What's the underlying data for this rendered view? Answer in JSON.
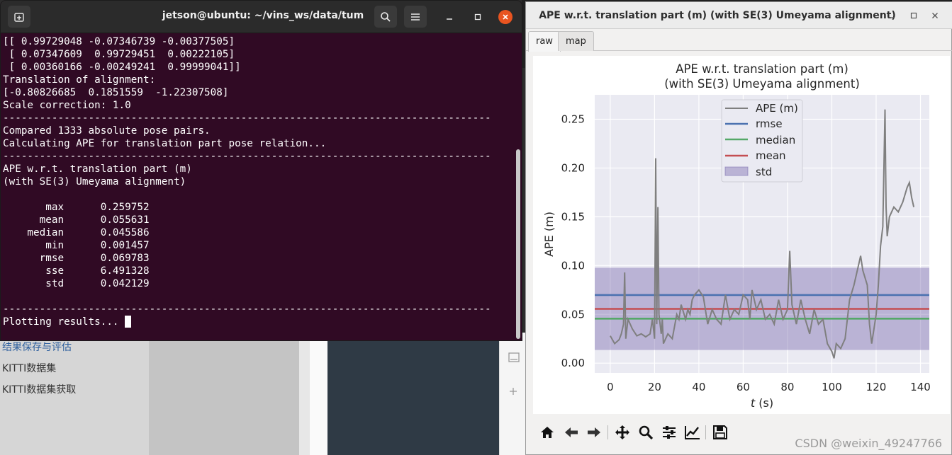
{
  "background": {
    "links": [
      "结果保存与评估",
      "KITTI数据集",
      "KITTI数据集获取"
    ]
  },
  "terminal": {
    "title": "jetson@ubuntu: ~/vins_ws/data/tum",
    "output": "[[ 0.99729048 -0.07346739 -0.00377505]\n [ 0.07347609  0.99729451  0.00222105]\n [ 0.00360166 -0.00249241  0.99999041]]\nTranslation of alignment:\n[-0.80826685  0.1851559  -1.22307508]\nScale correction: 1.0\n--------------------------------------------------------------------------------\nCompared 1333 absolute pose pairs.\nCalculating APE for translation part pose relation...\n--------------------------------------------------------------------------------\nAPE w.r.t. translation part (m)\n(with SE(3) Umeyama alignment)\n\n       max      0.259752\n      mean      0.055631\n    median      0.045586\n       min      0.001457\n      rmse      0.069783\n       sse      6.491328\n       std      0.042129\n\n--------------------------------------------------------------------------------\nPlotting results... "
  },
  "plot_window": {
    "title": "APE w.r.t. translation part (m) (with SE(3) Umeyama alignment)",
    "tabs": [
      "raw",
      "map"
    ],
    "active_tab": "raw",
    "toolbar": [
      "home-icon",
      "back-icon",
      "forward-icon",
      "pan-icon",
      "zoom-icon",
      "configure-subplots-icon",
      "edit-axis-icon",
      "save-icon"
    ]
  },
  "watermark": "CSDN @weixin_49247766",
  "chart_data": {
    "type": "line",
    "title_lines": [
      "APE w.r.t. translation part (m)",
      "(with SE(3) Umeyama alignment)"
    ],
    "xlabel_italic": "t",
    "xlabel_rest": " (s)",
    "ylabel": "APE (m)",
    "xlim": [
      -7,
      144
    ],
    "ylim": [
      -0.01,
      0.275
    ],
    "xticks": [
      0,
      20,
      40,
      60,
      80,
      100,
      120,
      140
    ],
    "yticks": [
      0.0,
      0.05,
      0.1,
      0.15,
      0.2,
      0.25
    ],
    "ytick_labels": [
      "0.00",
      "0.05",
      "0.10",
      "0.15",
      "0.20",
      "0.25"
    ],
    "grid": true,
    "legend_position": "top-center",
    "colors": {
      "ape": "#7f7f7f",
      "rmse": "#4c72b0",
      "median": "#55a868",
      "mean": "#c44e52",
      "std": "#8172b2",
      "plot_bg": "#eaeaf2"
    },
    "stats": {
      "rmse": 0.069783,
      "median": 0.045586,
      "mean": 0.055631,
      "std": 0.042129
    },
    "legend": [
      "APE (m)",
      "rmse",
      "median",
      "mean",
      "std"
    ],
    "series": [
      {
        "name": "APE (m)",
        "x": [
          0,
          2,
          4,
          5,
          6,
          6.5,
          7,
          8,
          10,
          12,
          14,
          16,
          18,
          19,
          20,
          20.5,
          21,
          21.5,
          22,
          23,
          23.5,
          24,
          25,
          26,
          28,
          30,
          31,
          32,
          34,
          35,
          36,
          37,
          38,
          40,
          42,
          44,
          46,
          48,
          50,
          52,
          54,
          56,
          58,
          60,
          62,
          63,
          64,
          66,
          68,
          70,
          72,
          74,
          76,
          78,
          80,
          81,
          82,
          84,
          86,
          88,
          90,
          92,
          94,
          96,
          98,
          100,
          101,
          102,
          104,
          106,
          108,
          110,
          112,
          113,
          114,
          116,
          117,
          118,
          119,
          120,
          121,
          122,
          123,
          124,
          124.5,
          125,
          126,
          128,
          130,
          132,
          134,
          135,
          136,
          137
        ],
        "y": [
          0.028,
          0.02,
          0.024,
          0.03,
          0.04,
          0.093,
          0.025,
          0.045,
          0.035,
          0.028,
          0.03,
          0.027,
          0.03,
          0.045,
          0.025,
          0.21,
          0.04,
          0.16,
          0.05,
          0.03,
          0.045,
          0.02,
          0.025,
          0.03,
          0.025,
          0.05,
          0.045,
          0.06,
          0.045,
          0.055,
          0.05,
          0.065,
          0.07,
          0.075,
          0.068,
          0.04,
          0.055,
          0.045,
          0.04,
          0.07,
          0.045,
          0.055,
          0.05,
          0.07,
          0.065,
          0.045,
          0.075,
          0.055,
          0.065,
          0.045,
          0.05,
          0.04,
          0.065,
          0.045,
          0.055,
          0.115,
          0.06,
          0.04,
          0.065,
          0.045,
          0.03,
          0.055,
          0.04,
          0.045,
          0.02,
          0.012,
          0.005,
          0.02,
          0.015,
          0.025,
          0.065,
          0.08,
          0.1,
          0.11,
          0.095,
          0.08,
          0.04,
          0.02,
          0.035,
          0.05,
          0.08,
          0.12,
          0.14,
          0.26,
          0.16,
          0.13,
          0.15,
          0.16,
          0.155,
          0.165,
          0.18,
          0.185,
          0.17,
          0.16
        ]
      }
    ]
  }
}
